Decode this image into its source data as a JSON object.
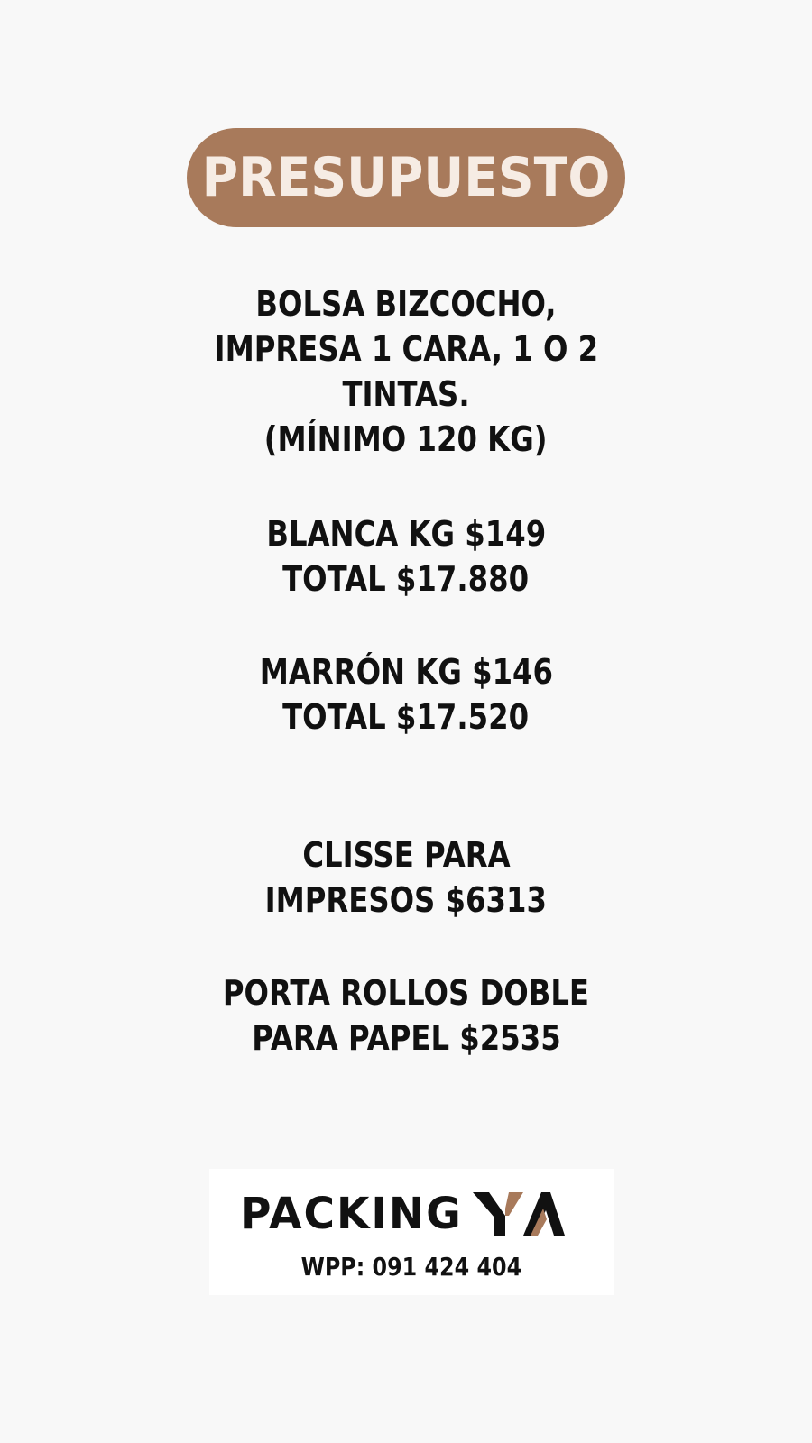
{
  "colors": {
    "accent": "#a87a5b",
    "text": "#111111",
    "background": "#f8f8f8",
    "header_text": "#f6ece4"
  },
  "header": {
    "title": "PRESUPUESTO"
  },
  "description": {
    "lines": [
      "BOLSA BIZCOCHO,",
      "IMPRESA 1 CARA, 1 O 2",
      "TINTAS.",
      "(MÍNIMO 120 KG)"
    ]
  },
  "options": [
    {
      "price_line": "BLANCA KG $149",
      "total_line": "TOTAL $17.880"
    },
    {
      "price_line": "MARRÓN KG $146",
      "total_line": "TOTAL $17.520"
    }
  ],
  "extras": [
    {
      "lines": [
        "CLISSE PARA",
        "IMPRESOS $6313"
      ]
    },
    {
      "lines": [
        "PORTA ROLLOS DOBLE",
        "PARA PAPEL $2535"
      ]
    }
  ],
  "logo": {
    "brand_text": "PACKING",
    "mark_text": "YA",
    "icon": "packingya-logo-mark",
    "contact": "WPP: 091 424 404"
  }
}
